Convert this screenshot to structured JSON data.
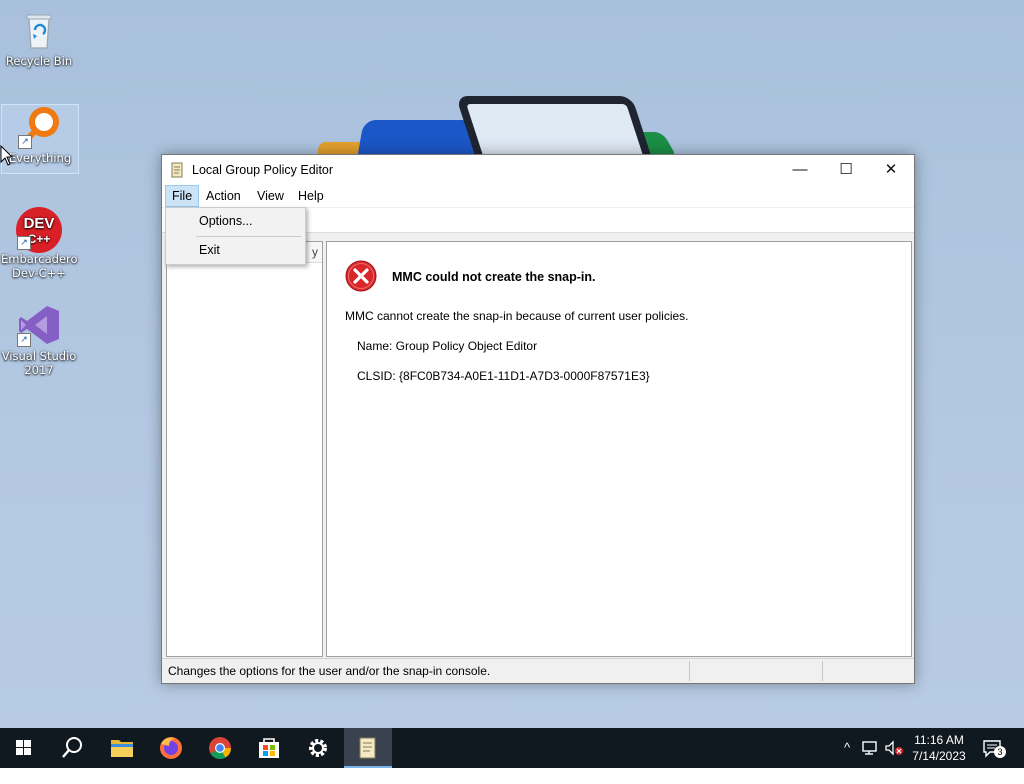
{
  "desktop": {
    "icons": [
      {
        "label": "Recycle Bin",
        "icon": "recycle-bin-icon"
      },
      {
        "label": "Everything",
        "icon": "everything-search-icon"
      },
      {
        "label": "Embarcadero Dev-C++",
        "icon": "devcpp-icon",
        "logo_text": "DEV C++"
      },
      {
        "label": "Visual Studio 2017",
        "icon": "visual-studio-icon"
      }
    ]
  },
  "window": {
    "title": "Local Group Policy Editor",
    "controls": {
      "minimize": "—",
      "maximize": "☐",
      "close": "✕"
    },
    "menu": [
      "File",
      "Action",
      "View",
      "Help"
    ],
    "file_menu": {
      "options": "Options...",
      "exit": "Exit"
    },
    "tree_header_fragment": "y",
    "error": {
      "title": "MMC could not create the snap-in.",
      "message": "MMC cannot create the snap-in because of current user policies.",
      "name": "Name: Group Policy Object Editor",
      "clsid": "CLSID: {8FC0B734-A0E1-11D1-A7D3-0000F87571E3}"
    },
    "status": "Changes the options for the user and/or the snap-in console."
  },
  "taskbar": {
    "items": [
      "start",
      "search",
      "file-explorer",
      "firefox",
      "chrome",
      "store",
      "settings",
      "group-policy"
    ],
    "tray": {
      "chevron": "^",
      "time": "11:16 AM",
      "date": "7/14/2023",
      "notifications": "3"
    }
  },
  "colors": {
    "error_red": "#d9262b",
    "taskbar": "#101820",
    "menu_highlight": "#cce4f7"
  }
}
